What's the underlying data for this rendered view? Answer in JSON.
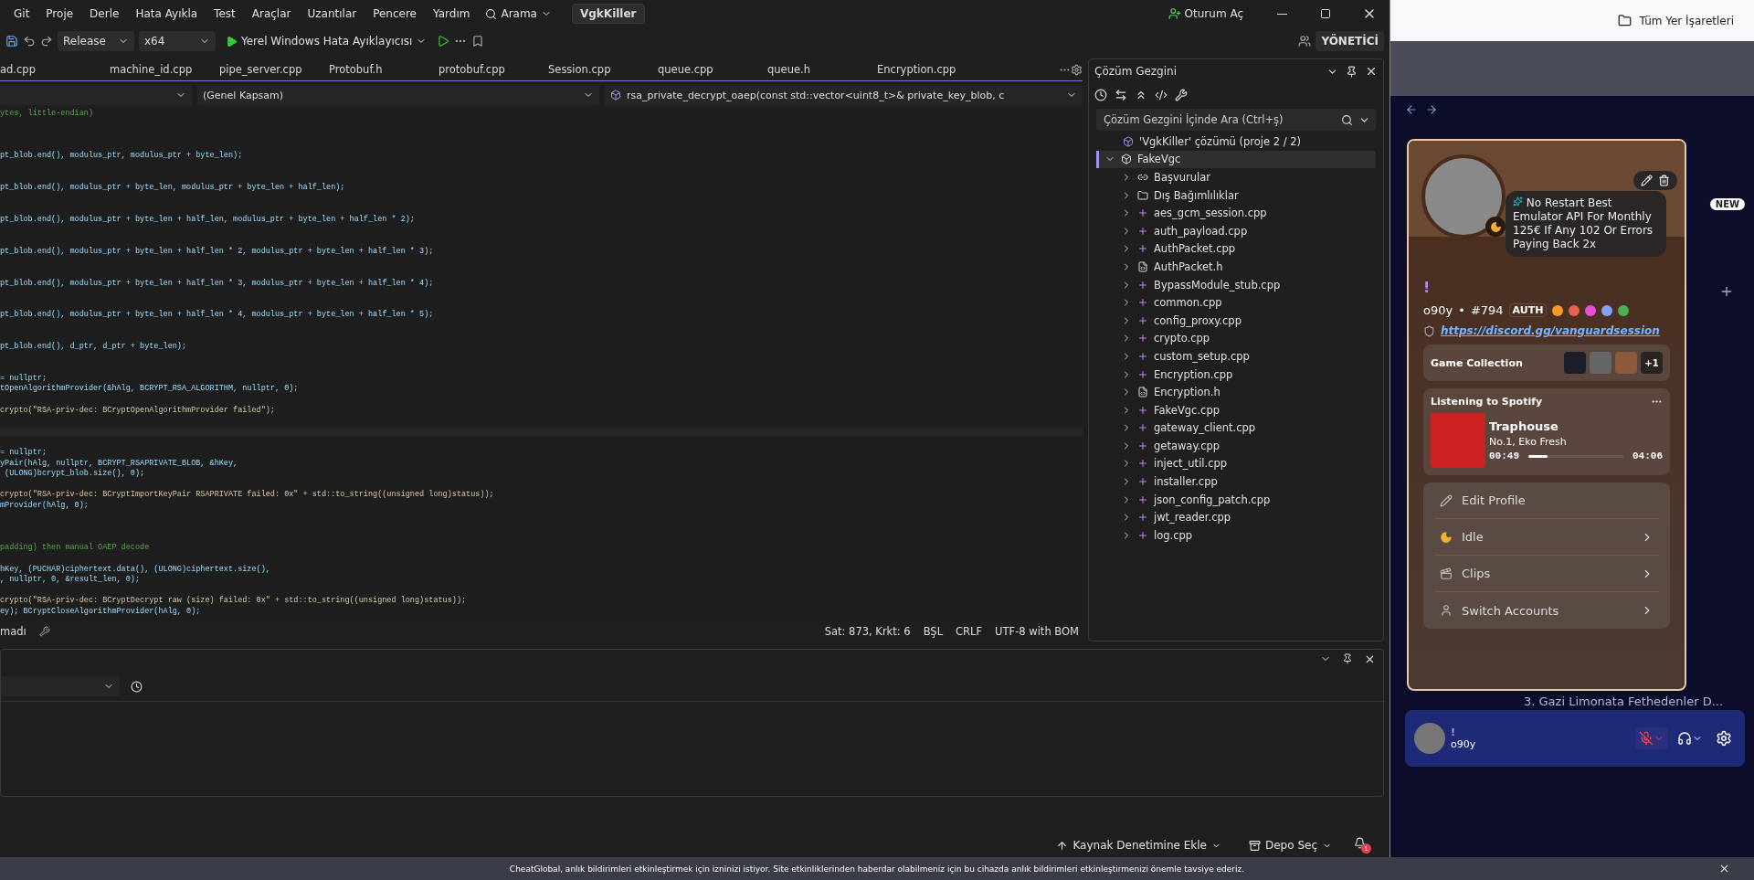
{
  "vs": {
    "menu": [
      "Git",
      "Proje",
      "Derle",
      "Hata Ayıkla",
      "Test",
      "Araçlar",
      "Uzantılar",
      "Pencere",
      "Yardım"
    ],
    "search": "Arama",
    "solution_badge": "VgkKiller",
    "sign_in": "Oturum Aç",
    "toolbar": {
      "configuration": "Release",
      "platform": "x64",
      "debugger": "Yerel Windows Hata Ayıklayıcısı",
      "role": "YÖNETİCİ"
    },
    "tabs": [
      {
        "label": "ad.cpp",
        "selected": false
      },
      {
        "label": "machine_id.cpp",
        "selected": false
      },
      {
        "label": "pipe_server.cpp",
        "selected": false
      },
      {
        "label": "Protobuf.h",
        "selected": false
      },
      {
        "label": "protobuf.cpp",
        "selected": false
      },
      {
        "label": "Session.cpp",
        "selected": false
      },
      {
        "label": "queue.cpp",
        "selected": false
      },
      {
        "label": "queue.h",
        "selected": false
      },
      {
        "label": "Encryption.cpp",
        "selected": false
      }
    ],
    "nav": {
      "scope": "(Genel Kapsam)",
      "member": "rsa_private_decrypt_oaep(const std::vector<uint8_t>& private_key_blob, c"
    },
    "code_lines": [
      {
        "kind": "comment",
        "text": "ytes, little-endian)"
      },
      {
        "kind": "blank"
      },
      {
        "kind": "blank"
      },
      {
        "kind": "blank"
      },
      {
        "kind": "code",
        "text": "pt_blob.end(), modulus_ptr, modulus_ptr + byte_len);"
      },
      {
        "kind": "blank"
      },
      {
        "kind": "blank"
      },
      {
        "kind": "code",
        "text": "pt_blob.end(), modulus_ptr + byte_len, modulus_ptr + byte_len + half_len);"
      },
      {
        "kind": "blank"
      },
      {
        "kind": "blank"
      },
      {
        "kind": "code",
        "text": "pt_blob.end(), modulus_ptr + byte_len + half_len, modulus_ptr + byte_len + half_len * 2);"
      },
      {
        "kind": "blank"
      },
      {
        "kind": "blank"
      },
      {
        "kind": "code",
        "text": "pt_blob.end(), modulus_ptr + byte_len + half_len * 2, modulus_ptr + byte_len + half_len * 3);"
      },
      {
        "kind": "blank"
      },
      {
        "kind": "blank"
      },
      {
        "kind": "code",
        "text": "pt_blob.end(), modulus_ptr + byte_len + half_len * 3, modulus_ptr + byte_len + half_len * 4);"
      },
      {
        "kind": "blank"
      },
      {
        "kind": "blank"
      },
      {
        "kind": "code",
        "text": "pt_blob.end(), modulus_ptr + byte_len + half_len * 4, modulus_ptr + byte_len + half_len * 5);"
      },
      {
        "kind": "blank"
      },
      {
        "kind": "blank"
      },
      {
        "kind": "code",
        "text": "pt_blob.end(), d_ptr, d_ptr + byte_len);"
      },
      {
        "kind": "blank"
      },
      {
        "kind": "blank"
      },
      {
        "kind": "code",
        "text": "= nullptr;"
      },
      {
        "kind": "code",
        "text": "tOpenAlgorithmProvider(&hAlg, BCRYPT_RSA_ALGORITHM, nullptr, 0);"
      },
      {
        "kind": "blank"
      },
      {
        "kind": "log",
        "text": "crypto(\"RSA-priv-dec: BCryptOpenAlgorithmProvider failed\");"
      },
      {
        "kind": "blank"
      },
      {
        "kind": "current"
      },
      {
        "kind": "blank"
      },
      {
        "kind": "code",
        "text": "= nullptr;"
      },
      {
        "kind": "code",
        "text": "yPair(hAlg, nullptr, BCRYPT_RSAPRIVATE_BLOB, &hKey,"
      },
      {
        "kind": "code",
        "text": " (ULONG)bcrypt_blob.size(), 0);"
      },
      {
        "kind": "blank"
      },
      {
        "kind": "log",
        "text": "crypto(\"RSA-priv-dec: BCryptImportKeyPair RSAPRIVATE failed: 0x\" + std::to_string((unsigned long)status));"
      },
      {
        "kind": "code",
        "text": "mProvider(hAlg, 0);"
      },
      {
        "kind": "blank"
      },
      {
        "kind": "blank"
      },
      {
        "kind": "blank"
      },
      {
        "kind": "comment",
        "text": "padding) then manual OAEP decode"
      },
      {
        "kind": "blank"
      },
      {
        "kind": "code",
        "text": "hKey, (PUCHAR)ciphertext.data(), (ULONG)ciphertext.size(),"
      },
      {
        "kind": "code",
        "text": ", nullptr, 0, &result_len, 0);"
      },
      {
        "kind": "blank"
      },
      {
        "kind": "log",
        "text": "crypto(\"RSA-priv-dec: BCryptDecrypt raw (size) failed: 0x\" + std::to_string((unsigned long)status));"
      },
      {
        "kind": "code",
        "text": "ey); BCryptCloseAlgorithmProvider(hAlg, 0);"
      }
    ],
    "editor_status": {
      "message": "madı",
      "position": "Sat: 873, Krkt: 6",
      "mode": "BŞL",
      "line_ending": "CRLF",
      "encoding": "UTF-8 with BOM"
    },
    "solution_explorer": {
      "title": "Çözüm Gezgini",
      "search": {
        "placeholder": "Çözüm Gezgini İçinde Ara (Ctrl+ş)"
      },
      "solution": "'VgkKiller' çözümü (proje 2 / 2)",
      "tree": [
        {
          "label": "FakeVgc",
          "kind": "project",
          "expanded": true,
          "selected": true,
          "children": [
            {
              "label": "Başvurular",
              "kind": "references",
              "expanded": false,
              "selected": false
            },
            {
              "label": "Dış Bağımlılıklar",
              "kind": "dependencies",
              "expanded": false,
              "selected": false
            },
            {
              "label": "aes_gcm_session.cpp",
              "kind": "source",
              "expanded": false,
              "selected": false
            },
            {
              "label": "auth_payload.cpp",
              "kind": "source",
              "expanded": false,
              "selected": false
            },
            {
              "label": "AuthPacket.cpp",
              "kind": "source",
              "expanded": false,
              "selected": false
            },
            {
              "label": "AuthPacket.h",
              "kind": "header",
              "expanded": false,
              "selected": false
            },
            {
              "label": "BypassModule_stub.cpp",
              "kind": "source",
              "expanded": false,
              "selected": false
            },
            {
              "label": "common.cpp",
              "kind": "source",
              "expanded": false,
              "selected": false
            },
            {
              "label": "config_proxy.cpp",
              "kind": "source",
              "expanded": false,
              "selected": false
            },
            {
              "label": "crypto.cpp",
              "kind": "source",
              "expanded": false,
              "selected": false
            },
            {
              "label": "custom_setup.cpp",
              "kind": "source",
              "expanded": false,
              "selected": false
            },
            {
              "label": "Encryption.cpp",
              "kind": "source",
              "expanded": false,
              "selected": false
            },
            {
              "label": "Encryption.h",
              "kind": "header",
              "expanded": false,
              "selected": false
            },
            {
              "label": "FakeVgc.cpp",
              "kind": "source",
              "expanded": false,
              "selected": false
            },
            {
              "label": "gateway_client.cpp",
              "kind": "source",
              "expanded": false,
              "selected": false
            },
            {
              "label": "getaway.cpp",
              "kind": "source",
              "expanded": false,
              "selected": false
            },
            {
              "label": "inject_util.cpp",
              "kind": "source",
              "expanded": false,
              "selected": false
            },
            {
              "label": "installer.cpp",
              "kind": "source",
              "expanded": false,
              "selected": false
            },
            {
              "label": "json_config_patch.cpp",
              "kind": "source",
              "expanded": false,
              "selected": false
            },
            {
              "label": "jwt_reader.cpp",
              "kind": "source",
              "expanded": false,
              "selected": false
            },
            {
              "label": "log.cpp",
              "kind": "source",
              "expanded": false,
              "selected": false
            }
          ]
        }
      ]
    },
    "status_bar": {
      "source_control": "Kaynak Denetimine Ekle",
      "repo": "Depo Seç",
      "notifications": "1"
    }
  },
  "browser": {
    "bookmarks": "Tüm Yer İşaretleri",
    "notification": "CheatGlobal, anlık bildirimleri etkinleştirmek için izninizi istiyor. Site etkinliklerinden haberdar olabilmeniz için bu cihazda anlık bildirimleri etkinleştirmenizi önemle tavsiye ederiz.",
    "discord": {
      "new_badge": "NEW",
      "channel": "3. Gazi Limonata Fethedenler D...",
      "user_bar": {
        "mark": "!",
        "name": "o90y"
      },
      "profile": {
        "status": "No Restart Best Emulator API For Monthly 125€ If Any 102 Or Errors Paying Back 2x",
        "mark": "!",
        "name": "o90y",
        "separator": "•",
        "tag": "#794",
        "guild_tag": "AUTH",
        "link": "https://discord.gg/vanguardsession",
        "games": {
          "title": "Game Collection",
          "more": "+1"
        },
        "spotify": {
          "title": "Listening to Spotify",
          "track": "Traphouse",
          "artist": "No.1, Eko Fresh",
          "elapsed": "00:49",
          "duration": "04:06",
          "level": 0.2
        },
        "menu": [
          {
            "label": "Edit Profile",
            "kind": "edit"
          },
          {
            "label": "Idle",
            "kind": "idle"
          },
          {
            "label": "Clips",
            "kind": "clips"
          },
          {
            "label": "Switch Accounts",
            "kind": "accounts"
          }
        ]
      }
    }
  }
}
